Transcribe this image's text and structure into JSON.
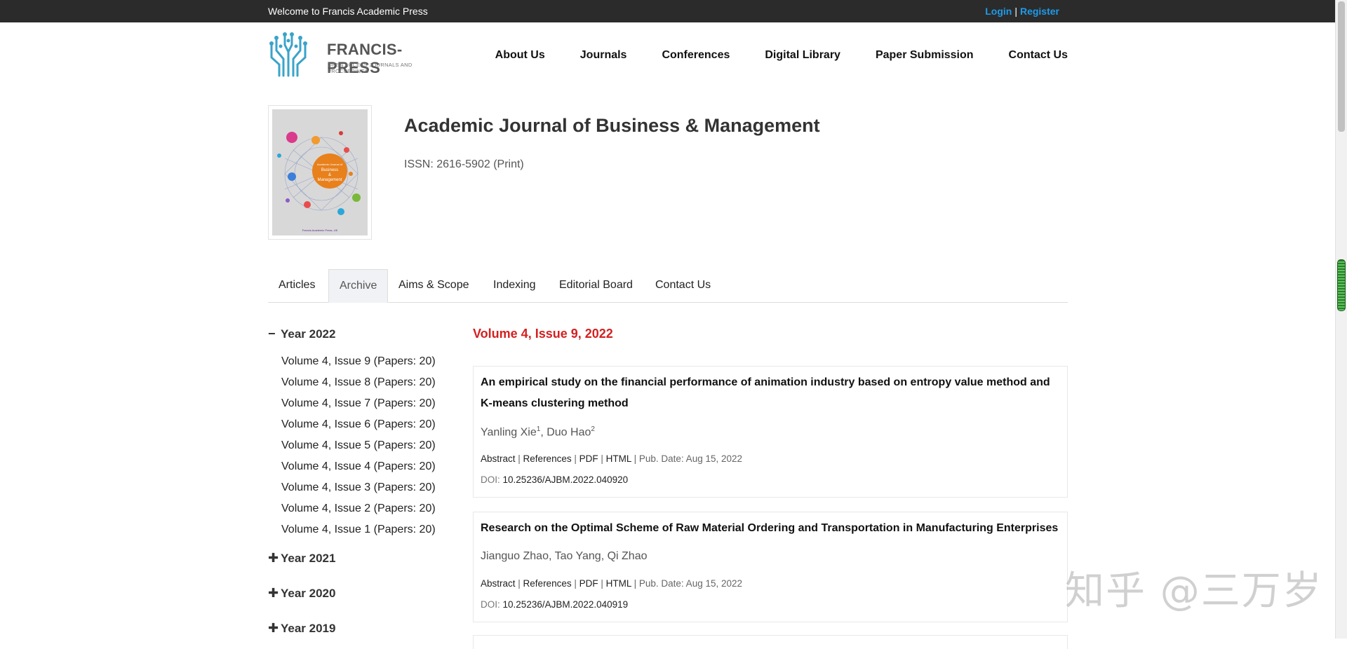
{
  "topbar": {
    "welcome": "Welcome to Francis Academic Press",
    "login": "Login",
    "separator": "|",
    "register": "Register"
  },
  "logo": {
    "brand": "FRANCIS-PRESS",
    "tagline": "OPEN ACCESS JOURNALS AND PROCEEDINGS"
  },
  "nav": [
    "About Us",
    "Journals",
    "Conferences",
    "Digital Library",
    "Paper Submission",
    "Contact Us"
  ],
  "journal": {
    "title": "Academic Journal of Business & Management",
    "issn": "ISSN: 2616-5902 (Print)",
    "cover_text_1": "Academic Journal of",
    "cover_text_2": "Business",
    "cover_text_3": "&",
    "cover_text_4": "Management",
    "cover_footer": "Francis Academic Press, UK"
  },
  "tabs": [
    "Articles",
    "Archive",
    "Aims & Scope",
    "Indexing",
    "Editorial Board",
    "Contact Us"
  ],
  "active_tab": "Archive",
  "sidebar": {
    "years": [
      {
        "label": "Year 2022",
        "expanded": true,
        "symbol": "−"
      },
      {
        "label": "Year 2021",
        "expanded": false,
        "symbol": "✚"
      },
      {
        "label": "Year 2020",
        "expanded": false,
        "symbol": "✚"
      },
      {
        "label": "Year 2019",
        "expanded": false,
        "symbol": "✚"
      }
    ],
    "issues": [
      "Volume 4, Issue 9 (Papers: 20)",
      "Volume 4, Issue 8 (Papers: 20)",
      "Volume 4, Issue 7 (Papers: 20)",
      "Volume 4, Issue 6 (Papers: 20)",
      "Volume 4, Issue 5 (Papers: 20)",
      "Volume 4, Issue 4 (Papers: 20)",
      "Volume 4, Issue 3 (Papers: 20)",
      "Volume 4, Issue 2 (Papers: 20)",
      "Volume 4, Issue 1 (Papers: 20)"
    ]
  },
  "content": {
    "issue_title": "Volume 4, Issue 9, 2022",
    "papers": [
      {
        "title": "An empirical study on the financial performance of animation industry based on entropy value method and K-means clustering method",
        "author_1": "Yanling Xie",
        "author_1_sup": "1",
        "author_sep": ", ",
        "author_2": "Duo Hao",
        "author_2_sup": "2",
        "abstract": "Abstract",
        "references": "References",
        "pdf": "PDF",
        "html": "HTML",
        "pub_date": "Pub. Date: Aug 15, 2022",
        "doi_label": "DOI:",
        "doi": "10.25236/AJBM.2022.040920"
      },
      {
        "title": "Research on the Optimal Scheme of Raw Material Ordering and Transportation in Manufacturing Enterprises",
        "authors": "Jianguo Zhao, Tao Yang, Qi Zhao",
        "abstract": "Abstract",
        "references": "References",
        "pdf": "PDF",
        "html": "HTML",
        "pub_date": "Pub. Date: Aug 15, 2022",
        "doi_label": "DOI:",
        "doi": "10.25236/AJBM.2022.040919"
      }
    ],
    "link_sep": " | "
  },
  "watermark": "知乎 @三万岁",
  "colors": {
    "topbar_bg": "#2b2b2b",
    "link_blue": "#1e9be8",
    "issue_red": "#d42020",
    "cover_orange": "#e8801c"
  }
}
